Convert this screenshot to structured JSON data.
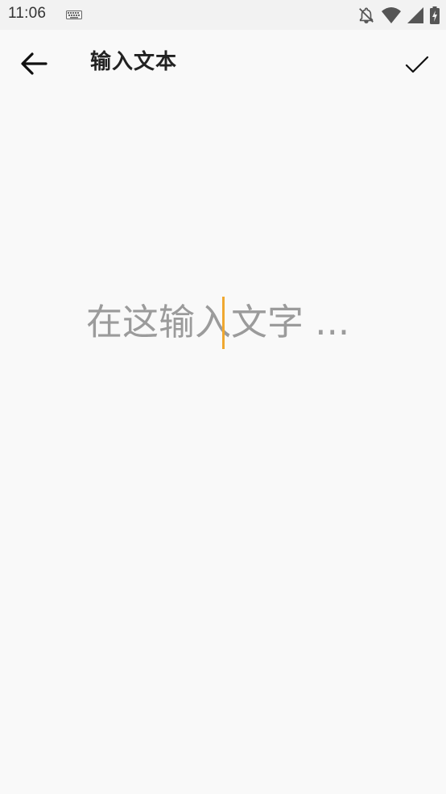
{
  "status_bar": {
    "time": "11:06",
    "icons": [
      "keyboard-icon",
      "notifications-off-icon",
      "wifi-icon",
      "signal-icon",
      "battery-charging-icon"
    ]
  },
  "app_bar": {
    "back_icon": "arrow-back-icon",
    "title": "输入文本",
    "confirm_icon": "check-icon"
  },
  "editor": {
    "placeholder": "在这输入文字 ...",
    "value": "",
    "caret_color": "#f0a830"
  },
  "colors": {
    "background": "#f9f9f9",
    "status_bar": "#f2f2f2",
    "title": "#222222",
    "placeholder": "#9b9b9b"
  }
}
